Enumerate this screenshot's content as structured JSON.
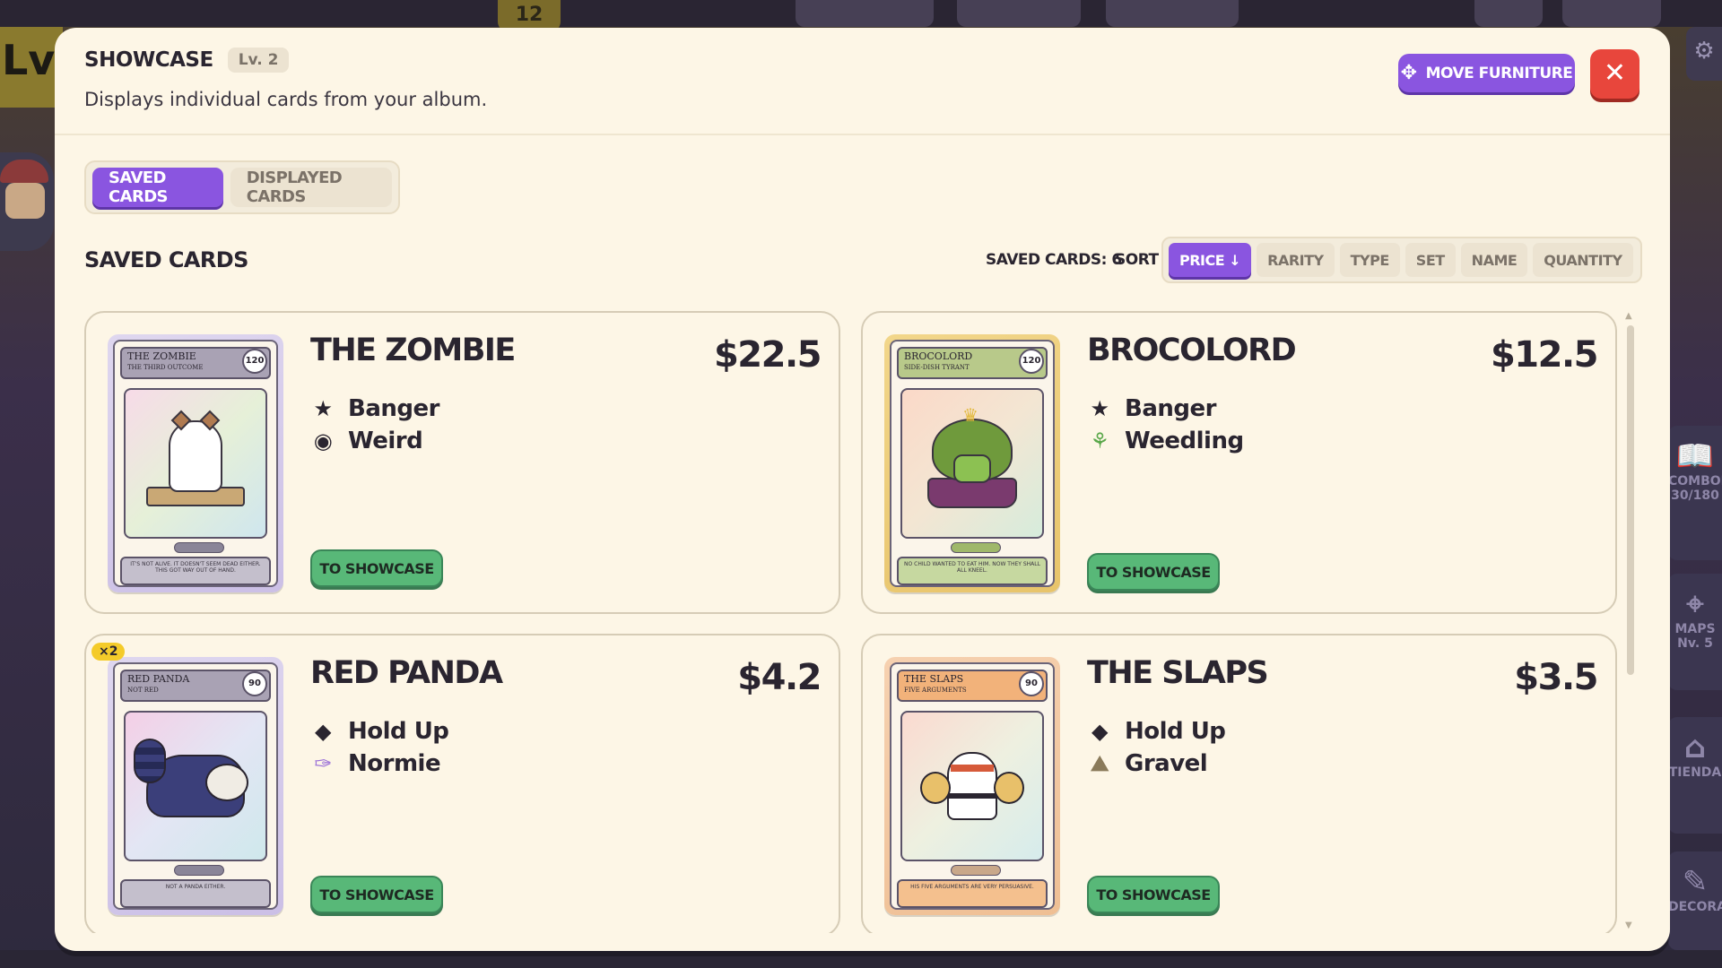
{
  "background": {
    "level_label": "Lvl",
    "badge_number": "12",
    "side_items": [
      {
        "label": "COMBODEX",
        "value": "30/180"
      },
      {
        "label": "MAPS",
        "value": "Nv. 5"
      },
      {
        "label": "TIENDA"
      },
      {
        "label": "DECORATE"
      }
    ]
  },
  "modal": {
    "title": "SHOWCASE",
    "level_badge": "Lv. 2",
    "subtitle": "Displays individual cards from your album.",
    "move_button": "MOVE FURNITURE",
    "close_symbol": "✕"
  },
  "tabs": [
    {
      "label": "SAVED CARDS",
      "active": true
    },
    {
      "label": "DISPLAYED CARDS",
      "active": false
    }
  ],
  "section": {
    "title": "SAVED CARDS",
    "count_label": "SAVED CARDS: 6",
    "sort_label": "SORT"
  },
  "sort_options": [
    {
      "label": "PRICE ↓",
      "active": true
    },
    {
      "label": "RARITY",
      "active": false
    },
    {
      "label": "TYPE",
      "active": false
    },
    {
      "label": "SET",
      "active": false
    },
    {
      "label": "NAME",
      "active": false
    },
    {
      "label": "QUANTITY",
      "active": false
    }
  ],
  "cards": [
    {
      "name": "THE ZOMBIE",
      "price": "$22.5",
      "rarity": {
        "label": "Banger",
        "icon": "star-icon"
      },
      "type": {
        "label": "Weird",
        "icon": "eye-icon"
      },
      "button": "TO SHOWCASE",
      "art": {
        "name": "THE ZOMBIE",
        "sub": "THE THIRD OUTCOME",
        "hp": "120",
        "desc": "IT'S NOT ALIVE. IT DOESN'T SEEM DEAD EITHER. THIS GOT WAY OUT OF HAND."
      }
    },
    {
      "name": "BROCOLORD",
      "price": "$12.5",
      "rarity": {
        "label": "Banger",
        "icon": "star-icon"
      },
      "type": {
        "label": "Weedling",
        "icon": "sprout-icon"
      },
      "button": "TO SHOWCASE",
      "art": {
        "name": "BROCOLORD",
        "sub": "SIDE-DISH TYRANT",
        "hp": "120",
        "desc": "NO CHILD WANTED TO EAT HIM. NOW THEY SHALL ALL KNEEL."
      }
    },
    {
      "name": "RED PANDA",
      "price": "$4.2",
      "quantity": "×2",
      "rarity": {
        "label": "Hold Up",
        "icon": "diamond-icon"
      },
      "type": {
        "label": "Normie",
        "icon": "feather-icon"
      },
      "button": "TO SHOWCASE",
      "art": {
        "name": "RED PANDA",
        "sub": "NOT RED",
        "hp": "90",
        "desc": "NOT A PANDA EITHER."
      }
    },
    {
      "name": "THE SLAPS",
      "price": "$3.5",
      "rarity": {
        "label": "Hold Up",
        "icon": "diamond-icon"
      },
      "type": {
        "label": "Gravel",
        "icon": "mountain-icon"
      },
      "button": "TO SHOWCASE",
      "art": {
        "name": "THE SLAPS",
        "sub": "FIVE ARGUMENTS",
        "hp": "90",
        "desc": "HIS FIVE ARGUMENTS ARE VERY PERSUASIVE."
      }
    }
  ]
}
